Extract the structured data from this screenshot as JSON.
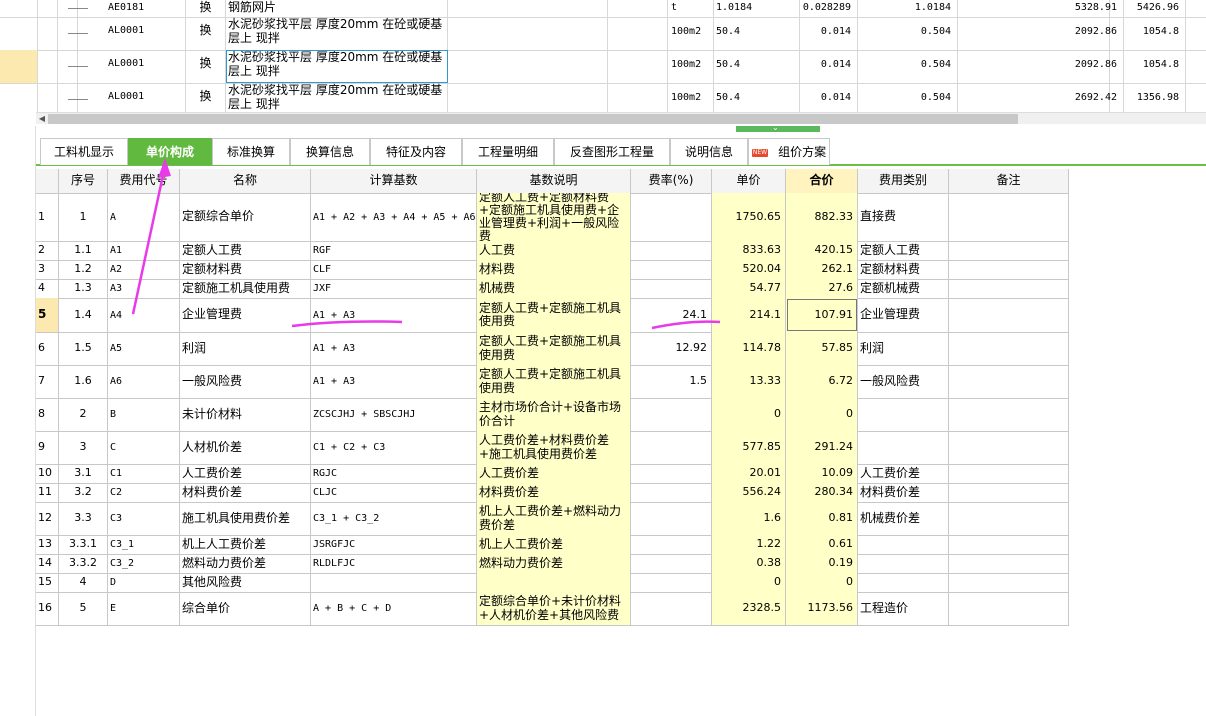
{
  "top_rows": [
    {
      "code": "AE0181",
      "type": "换",
      "name": "钢筋网片",
      "unit": "t",
      "qty": "1.0184",
      "content": "0.028289",
      "amount": "1.0184",
      "price": "5328.91",
      "total": "5426.96"
    },
    {
      "code": "AL0001",
      "type": "换",
      "name": "水泥砂浆找平层 厚度20mm 在砼或硬基层上 现拌",
      "unit": "100m2",
      "qty": "50.4",
      "content": "0.014",
      "amount": "0.504",
      "price": "2092.86",
      "total": "1054.8"
    },
    {
      "code": "AL0001",
      "type": "换",
      "name": "水泥砂浆找平层 厚度20mm 在砼或硬基层上 现拌",
      "unit": "100m2",
      "qty": "50.4",
      "content": "0.014",
      "amount": "0.504",
      "price": "2092.86",
      "total": "1054.8"
    },
    {
      "code": "AL0001",
      "type": "换",
      "name": "水泥砂浆找平层 厚度20mm 在砼或硬基层上 现拌",
      "unit": "100m2",
      "qty": "50.4",
      "content": "0.014",
      "amount": "0.504",
      "price": "2692.42",
      "total": "1356.98"
    }
  ],
  "tabs": [
    {
      "label": "工料机显示"
    },
    {
      "label": "单价构成",
      "active": true
    },
    {
      "label": "标准换算"
    },
    {
      "label": "换算信息"
    },
    {
      "label": "特征及内容"
    },
    {
      "label": "工程量明细"
    },
    {
      "label": "反查图形工程量"
    },
    {
      "label": "说明信息"
    },
    {
      "label": "组价方案",
      "badge": "NEW"
    }
  ],
  "columns": {
    "seq": "序号",
    "code": "费用代号",
    "name": "名称",
    "base": "计算基数",
    "desc": "基数说明",
    "rate": "费率(%)",
    "unit_price": "单价",
    "total": "合价",
    "category": "费用类别",
    "remark": "备注"
  },
  "rows": [
    {
      "n": "1",
      "seq": "1",
      "code": "A",
      "name": "定额综合单价",
      "base": "A1 + A2 + A3 + A4 + A5 + A6",
      "desc": "定额人工费+定额材料费+定额施工机具使用费+企业管理费+利润+一般风险费",
      "rate": "",
      "unit_price": "1750.65",
      "total": "882.33",
      "category": "直接费",
      "remark": ""
    },
    {
      "n": "2",
      "seq": "1.1",
      "code": "A1",
      "name": "定额人工费",
      "base": "RGF",
      "desc": "人工费",
      "rate": "",
      "unit_price": "833.63",
      "total": "420.15",
      "category": "定额人工费",
      "remark": ""
    },
    {
      "n": "3",
      "seq": "1.2",
      "code": "A2",
      "name": "定额材料费",
      "base": "CLF",
      "desc": "材料费",
      "rate": "",
      "unit_price": "520.04",
      "total": "262.1",
      "category": "定额材料费",
      "remark": ""
    },
    {
      "n": "4",
      "seq": "1.3",
      "code": "A3",
      "name": "定额施工机具使用费",
      "base": "JXF",
      "desc": "机械费",
      "rate": "",
      "unit_price": "54.77",
      "total": "27.6",
      "category": "定额机械费",
      "remark": ""
    },
    {
      "n": "5",
      "seq": "1.4",
      "code": "A4",
      "name": "企业管理费",
      "base": "A1 + A3",
      "desc": "定额人工费+定额施工机具使用费",
      "rate": "24.1",
      "unit_price": "214.1",
      "total": "107.91",
      "category": "企业管理费",
      "remark": "",
      "current": true
    },
    {
      "n": "6",
      "seq": "1.5",
      "code": "A5",
      "name": "利润",
      "base": "A1 + A3",
      "desc": "定额人工费+定额施工机具使用费",
      "rate": "12.92",
      "unit_price": "114.78",
      "total": "57.85",
      "category": "利润",
      "remark": ""
    },
    {
      "n": "7",
      "seq": "1.6",
      "code": "A6",
      "name": "一般风险费",
      "base": "A1 + A3",
      "desc": "定额人工费+定额施工机具使用费",
      "rate": "1.5",
      "unit_price": "13.33",
      "total": "6.72",
      "category": "一般风险费",
      "remark": ""
    },
    {
      "n": "8",
      "seq": "2",
      "code": "B",
      "name": "未计价材料",
      "base": "ZCSCJHJ + SBSCJHJ",
      "desc": "主材市场价合计+设备市场价合计",
      "rate": "",
      "unit_price": "0",
      "total": "0",
      "category": "",
      "remark": ""
    },
    {
      "n": "9",
      "seq": "3",
      "code": "C",
      "name": "人材机价差",
      "base": "C1 + C2 + C3",
      "desc": "人工费价差+材料费价差+施工机具使用费价差",
      "rate": "",
      "unit_price": "577.85",
      "total": "291.24",
      "category": "",
      "remark": ""
    },
    {
      "n": "10",
      "seq": "3.1",
      "code": "C1",
      "name": "人工费价差",
      "base": "RGJC",
      "desc": "人工费价差",
      "rate": "",
      "unit_price": "20.01",
      "total": "10.09",
      "category": "人工费价差",
      "remark": ""
    },
    {
      "n": "11",
      "seq": "3.2",
      "code": "C2",
      "name": "材料费价差",
      "base": "CLJC",
      "desc": "材料费价差",
      "rate": "",
      "unit_price": "556.24",
      "total": "280.34",
      "category": "材料费价差",
      "remark": ""
    },
    {
      "n": "12",
      "seq": "3.3",
      "code": "C3",
      "name": "施工机具使用费价差",
      "base": "C3_1 + C3_2",
      "desc": "机上人工费价差+燃料动力费价差",
      "rate": "",
      "unit_price": "1.6",
      "total": "0.81",
      "category": "机械费价差",
      "remark": ""
    },
    {
      "n": "13",
      "seq": "3.3.1",
      "code": "C3_1",
      "name": "机上人工费价差",
      "base": "JSRGFJC",
      "desc": "机上人工费价差",
      "rate": "",
      "unit_price": "1.22",
      "total": "0.61",
      "category": "",
      "remark": ""
    },
    {
      "n": "14",
      "seq": "3.3.2",
      "code": "C3_2",
      "name": "燃料动力费价差",
      "base": "RLDLFJC",
      "desc": "燃料动力费价差",
      "rate": "",
      "unit_price": "0.38",
      "total": "0.19",
      "category": "",
      "remark": ""
    },
    {
      "n": "15",
      "seq": "4",
      "code": "D",
      "name": "其他风险费",
      "base": "",
      "desc": "",
      "rate": "",
      "unit_price": "0",
      "total": "0",
      "category": "",
      "remark": ""
    },
    {
      "n": "16",
      "seq": "5",
      "code": "E",
      "name": "综合单价",
      "base": "A + B + C + D",
      "desc": "定额综合单价+未计价材料+人材机价差+其他风险费",
      "rate": "",
      "unit_price": "2328.5",
      "total": "1173.56",
      "category": "工程造价",
      "remark": ""
    }
  ],
  "colors": {
    "accent": "#62b93f",
    "highlight_col": "#ffffc8",
    "annotation": "#e83ae8"
  }
}
